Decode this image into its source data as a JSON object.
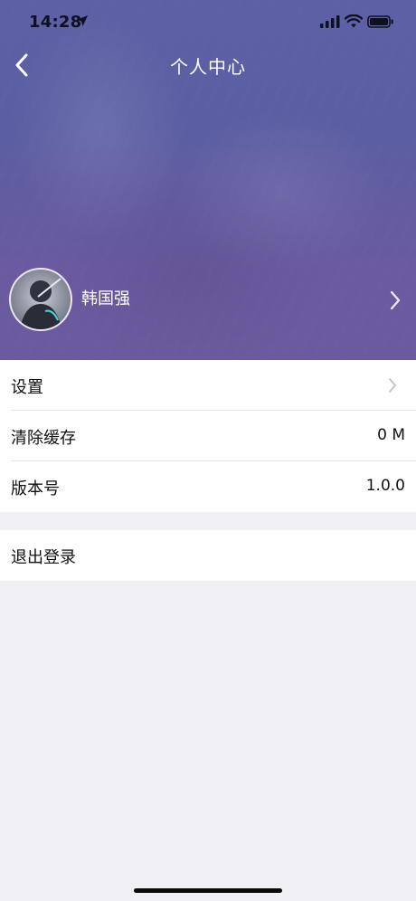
{
  "status_bar": {
    "time": "14:28",
    "icons": [
      "location-arrow-icon",
      "signal-icon",
      "wifi-icon",
      "battery-icon"
    ]
  },
  "nav": {
    "title": "个人中心",
    "back_icon": "chevron-left-icon"
  },
  "profile": {
    "name": "韩国强",
    "avatar_icon": "avatar",
    "arrow_icon": "chevron-right-icon"
  },
  "list": {
    "items": [
      {
        "label": "设置",
        "value": "",
        "accessory": "chevron-right-icon"
      },
      {
        "label": "清除缓存",
        "value": "0 M"
      },
      {
        "label": "版本号",
        "value": "1.0.0"
      }
    ],
    "logout": {
      "label": "退出登录"
    }
  },
  "colors": {
    "hero_start": "#5d60a4",
    "hero_end": "#6c5a9e",
    "background": "#efeff4",
    "list_bg": "#ffffff",
    "divider": "#e6e6ea"
  }
}
